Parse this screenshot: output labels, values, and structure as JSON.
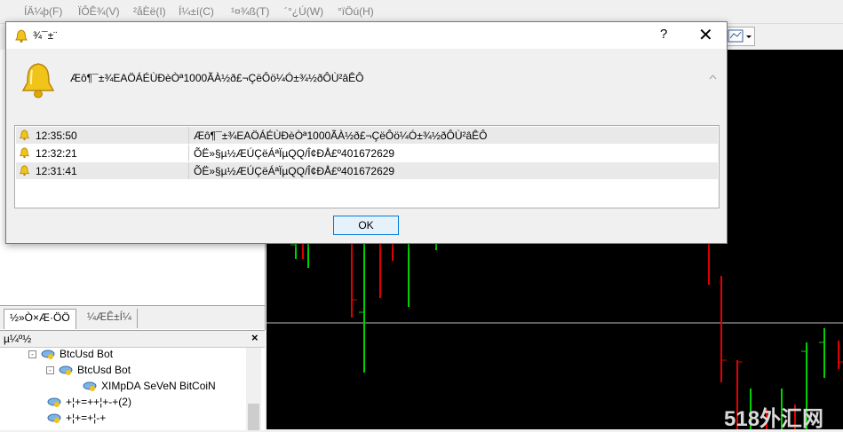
{
  "menu": [
    "ÍÄ¼þ(F)",
    "ÏÔÊ¾(V)",
    "²åÈë(I)",
    "Í¼±í(C)",
    "¹¤¾ß(T)",
    "´°¿Ú(W)",
    "°ïÖú(H)"
  ],
  "left_tabs": [
    "½»Ò×Æ·ÖÖ",
    "¼ÆÊ±Í¼"
  ],
  "navigator": {
    "title": "µ¼º½",
    "close": "×",
    "items": [
      {
        "label": "BtcUsd Bot"
      },
      {
        "label": "BtcUsd Bot"
      },
      {
        "label": "XIMpDA SeVeN BitCoiN"
      },
      {
        "label": "+¦+=++¦+-+(2)"
      },
      {
        "label": "+¦+=+¦-+"
      }
    ]
  },
  "dialog": {
    "title": "¾¯±¨",
    "help": "?",
    "close": "✕",
    "message": "Æô¶¯±¾EAÖÁÉÙÐèÒª1000ÃÀ½ð£¬ÇëÔö¼Ó±¾½ðÔÙ²âÊÔ",
    "rows": [
      {
        "time": "12:35:50",
        "text": "Æô¶¯±¾EAÖÁÉÙÐèÒª1000ÃÀ½ð£¬ÇëÔö¼Ó±¾½ðÔÙ²âÊÔ"
      },
      {
        "time": "12:32:21",
        "text": "ÕË»§µ½ÆÚÇëÁªÏµQQ/Î¢ÐÅ£º401672629"
      },
      {
        "time": "12:31:41",
        "text": "ÕË»§µ½ÆÚÇëÁªÏµQQ/Î¢ÐÅ£º401672629"
      }
    ],
    "ok_label": "OK"
  },
  "watermark": "518外汇网",
  "colors": {
    "bull": "#00d000",
    "bear": "#e00000",
    "chart_bg": "#000000",
    "bell": "#f0c419",
    "ok_border": "#0078d7"
  }
}
